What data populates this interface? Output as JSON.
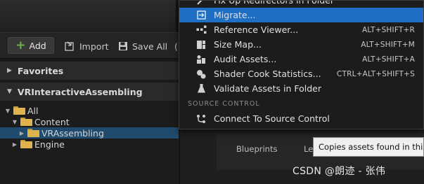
{
  "toolbar": {
    "add_label": "Add",
    "import_label": "Import",
    "save_all_label": "Save All",
    "extra_label": "("
  },
  "left_panel": {
    "favorites_label": "Favorites",
    "project_label": "VRInteractiveAssembling",
    "tree": [
      {
        "label": "All"
      },
      {
        "label": "Content"
      },
      {
        "label": "VRAssembling"
      },
      {
        "label": "Engine"
      }
    ]
  },
  "context_menu": {
    "items": [
      {
        "label": "Fix Up Redirectors in Folder",
        "shortcut": "",
        "icon": "fix-redirectors-icon"
      },
      {
        "label": "Migrate...",
        "shortcut": "",
        "icon": "migrate-icon"
      },
      {
        "label": "Reference Viewer...",
        "shortcut": "ALT+SHIFT+R",
        "icon": "reference-viewer-icon"
      },
      {
        "label": "Size Map...",
        "shortcut": "ALT+SHIFT+M",
        "icon": "size-map-icon"
      },
      {
        "label": "Audit Assets...",
        "shortcut": "ALT+SHIFT+A",
        "icon": "audit-assets-icon"
      },
      {
        "label": "Shader Cook Statistics...",
        "shortcut": "CTRL+ALT+SHIFT+S",
        "icon": "shader-stats-icon"
      },
      {
        "label": "Validate Assets in Folder",
        "shortcut": "",
        "icon": "validate-icon"
      }
    ],
    "section_label": "SOURCE CONTROL",
    "source_control_item": {
      "label": "Connect To Source Control",
      "icon": "source-control-icon"
    }
  },
  "right_panel": {
    "tab_blueprints": "Blueprints",
    "tab_partial": "Le",
    "tooltip_text": "Copies assets found in this f"
  },
  "watermark": "CSDN @朗迹 - 张伟",
  "colors": {
    "highlight": "#1f6fc5",
    "selected_row": "#214b6e",
    "folder": "#e0b44c",
    "add_plus": "#6ab04c",
    "tooltip_bg": "#f0f0f0"
  }
}
